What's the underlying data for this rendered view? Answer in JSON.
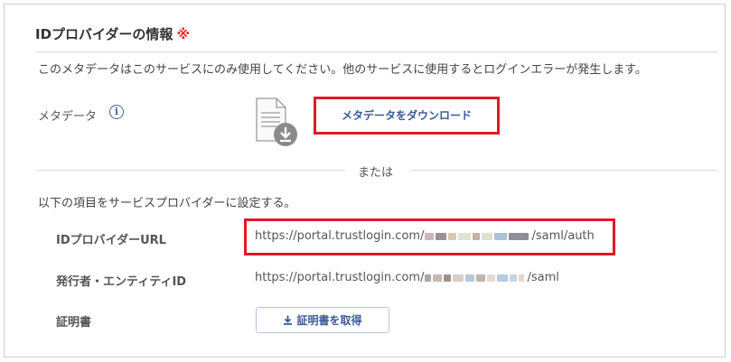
{
  "section": {
    "title": "IDプロバイダーの情報",
    "required_mark": "※",
    "notice": "このメタデータはこのサービスにのみ使用してください。他のサービスに使用するとログインエラーが発生します。"
  },
  "metadata": {
    "label": "メタデータ",
    "info_icon": "info-icon",
    "file_icon": "file-download-icon",
    "download_button_label": "メタデータをダウンロード"
  },
  "divider": {
    "or_text": "または"
  },
  "settings": {
    "description": "以下の項目をサービスプロバイダーに設定する。",
    "idp_url": {
      "label": "IDプロバイダーURL",
      "value_prefix": "https://portal.trustlogin.com/",
      "value_suffix": "/saml/auth"
    },
    "issuer": {
      "label": "発行者・エンティティID",
      "value_prefix": "https://portal.trustlogin.com/",
      "value_suffix": "/saml"
    },
    "certificate": {
      "label": "証明書",
      "button_label": "証明書を取得",
      "button_icon": "download-icon"
    }
  },
  "colors": {
    "highlight": "#e01a25",
    "required": "#e03030",
    "button_text": "#3b5a9a",
    "info_icon": "#3a6aa8"
  }
}
